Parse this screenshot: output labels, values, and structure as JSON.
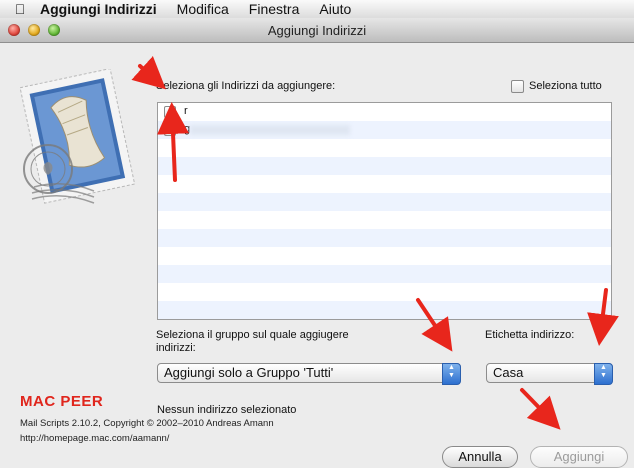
{
  "menubar": {
    "apple_icon": "apple-logo-icon",
    "app": "Aggiungi Indirizzi",
    "items": [
      "Modifica",
      "Finestra",
      "Aiuto"
    ]
  },
  "window": {
    "title": "Aggiungi Indirizzi"
  },
  "dialog": {
    "prompt": "Seleziona gli Indirizzi da aggiungere:",
    "select_all_label": "Seleziona tutto",
    "rows": [
      {
        "text": "r",
        "checked": false
      },
      {
        "text": "g",
        "checked": false
      }
    ],
    "group_label_line1": "Seleziona il gruppo sul quale aggiugere",
    "group_label_line2": "indirizzi:",
    "group_value": "Aggiungi solo a Gruppo 'Tutti'",
    "label_label": "Etichetta indirizzo:",
    "label_value": "Casa",
    "status": "Nessun indirizzo selezionato",
    "cancel": "Annulla",
    "add": "Aggiungi"
  },
  "footer": {
    "brand": "MAC PEER",
    "version": "Mail Scripts 2.10.2, Copyright © 2002–2010 Andreas Amann",
    "url": "http://homepage.mac.com/aamann/"
  },
  "colors": {
    "arrow": "#e8261c",
    "row_alt": "#edf3fe",
    "popup_arrow": "#2d6fcf",
    "brand": "#e0261d"
  }
}
